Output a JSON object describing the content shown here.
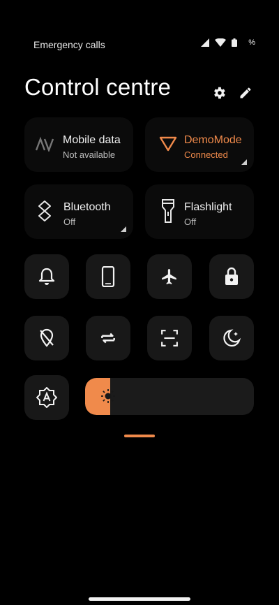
{
  "status": {
    "carrier": "Emergency calls",
    "battery_percent": "%"
  },
  "header": {
    "title": "Control centre"
  },
  "tiles": {
    "mobile": {
      "label": "Mobile data",
      "sub": "Not available"
    },
    "demo": {
      "label": "DemoMode",
      "sub": "Connected"
    },
    "bluetooth": {
      "label": "Bluetooth",
      "sub": "Off"
    },
    "flashlight": {
      "label": "Flashlight",
      "sub": "Off"
    }
  },
  "brightness": {
    "level": 0.15
  },
  "colors": {
    "accent": "#f08a4b",
    "tile_bg": "#181818"
  },
  "icons": [
    "settings-icon",
    "edit-icon",
    "mobile-data-icon",
    "vpn-icon",
    "bluetooth-icon",
    "flashlight-icon",
    "bell-icon",
    "phone-icon",
    "airplane-icon",
    "lock-icon",
    "location-off-icon",
    "sync-icon",
    "screenshot-icon",
    "night-mode-icon",
    "auto-brightness-icon",
    "brightness-icon"
  ]
}
